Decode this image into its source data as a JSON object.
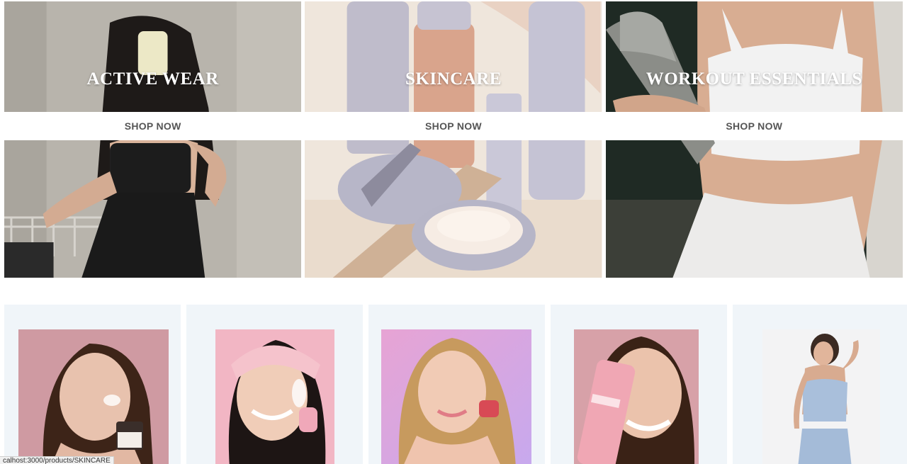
{
  "categories": [
    {
      "title": "ACTIVE WEAR",
      "button": "SHOP NOW",
      "image_icon": "active-wear-photo"
    },
    {
      "title": "SKINCARE",
      "button": "SHOP NOW",
      "image_icon": "skincare-photo"
    },
    {
      "title": "WORKOUT ESSENTIALS",
      "button": "SHOP NOW",
      "image_icon": "workout-essentials-photo"
    }
  ],
  "products": [
    {
      "image_icon": "woman-applying-face-cream-photo"
    },
    {
      "image_icon": "woman-with-headband-skincare-photo"
    },
    {
      "image_icon": "woman-with-lip-balm-photo"
    },
    {
      "image_icon": "woman-with-pink-tube-photo"
    },
    {
      "image_icon": "woman-in-blue-activewear-photo"
    }
  ],
  "status_bar": {
    "url": "calhost:3000/products/SKINCARE"
  },
  "colors": {
    "card_background": "#f0f5f9",
    "button_text": "#555555",
    "banner_title": "#ffffff"
  }
}
